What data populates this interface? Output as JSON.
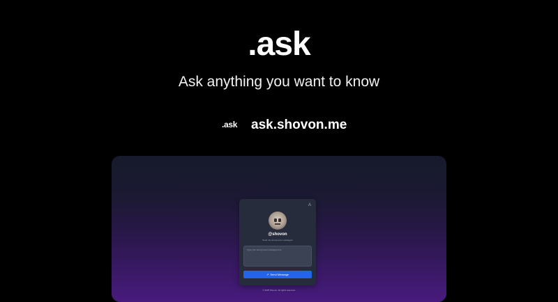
{
  "hero": {
    "title": ".ask",
    "subtitle": "Ask anything you want to know"
  },
  "brand": {
    "logo_text": ".ask",
    "domain": "ask.shovon.me"
  },
  "preview": {
    "card": {
      "top_icon": "A",
      "username": "@shovon",
      "hint": "Send me anonymous messages!",
      "textarea_placeholder": "Type your anonymous message here",
      "send_label": "Send Message",
      "send_icon": "↗"
    },
    "footer": "© 2025 Shovon. All rights reserved."
  },
  "colors": {
    "background": "#000000",
    "accent": "#2563eb",
    "card": "#262c3b",
    "gradient_top": "#161a2b",
    "gradient_bottom": "#481a7e"
  },
  "icons": {
    "card_top": "translate-icon",
    "send": "send-icon"
  }
}
